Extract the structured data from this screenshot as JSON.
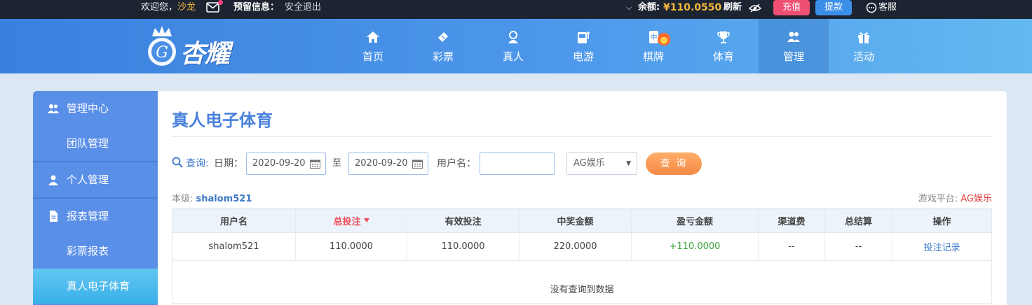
{
  "topbar": {
    "welcome": "欢迎您，",
    "username": "沙龙",
    "reserved_label": "预留信息：",
    "logout": "安全退出",
    "balance_label": "余额:",
    "balance_value": "¥110.0550",
    "refresh": "刷新",
    "recharge": "充值",
    "withdraw": "提款",
    "service": "客服"
  },
  "nav": {
    "logo_text": "杏耀",
    "items": [
      {
        "label": "首页",
        "icon": "home-icon"
      },
      {
        "label": "彩票",
        "icon": "lottery-ticket-icon"
      },
      {
        "label": "真人",
        "icon": "live-dealer-icon"
      },
      {
        "label": "电游",
        "icon": "slot-machine-icon"
      },
      {
        "label": "棋牌",
        "icon": "mahjong-tile-icon"
      },
      {
        "label": "体育",
        "icon": "trophy-icon"
      },
      {
        "label": "管理",
        "icon": "users-icon"
      },
      {
        "label": "活动",
        "icon": "gift-icon"
      }
    ],
    "active": "管理"
  },
  "sidebar": {
    "items": [
      {
        "label": "管理中心",
        "icon": "users-icon"
      },
      {
        "label": "团队管理"
      },
      {
        "label": "个人管理",
        "icon": "user-icon"
      },
      {
        "label": "报表管理",
        "icon": "report-icon"
      },
      {
        "label": "彩票报表"
      },
      {
        "label": "真人电子体育"
      }
    ]
  },
  "main": {
    "title": "真人电子体育",
    "query": {
      "label": "查询:",
      "date_label": "日期：",
      "start_date": "2020-09-20",
      "to": "至",
      "end_date": "2020-09-20",
      "username_label": "用户名：",
      "username_value": "",
      "platform_selected": "AG娱乐",
      "button": "查 询"
    },
    "level_label": "本级:",
    "level_user": "shalom521",
    "platform_label": "游戏平台:",
    "platform_value": "AG娱乐",
    "table": {
      "headers": [
        "用户名",
        "总投注",
        "有效投注",
        "中奖金额",
        "盈亏金额",
        "渠道费",
        "总结算",
        "操作"
      ],
      "row": [
        "shalom521",
        "110.0000",
        "110.0000",
        "220.0000",
        "+110.0000",
        "--",
        "--",
        "投注记录"
      ],
      "empty_text": "没有查询到数据"
    }
  },
  "colors": {
    "accent": "#4a82dc",
    "sidebar": "#5a8fe8",
    "active_sidebar": "#39b1ea",
    "gold": "#f5b83b",
    "positive": "#3aa33a",
    "sorted": "#ef4f5a"
  }
}
